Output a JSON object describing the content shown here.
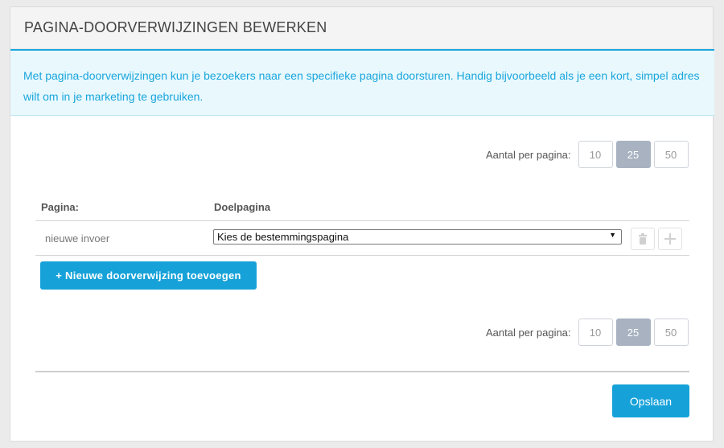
{
  "header": {
    "title": "PAGINA-DOORVERWIJZINGEN BEWERKEN"
  },
  "info": {
    "text": "Met pagina-doorverwijzingen kun je bezoekers naar een specifieke pagina doorsturen. Handig bijvoorbeeld als je een kort, simpel adres wilt om in je marketing te gebruiken."
  },
  "pagination": {
    "label": "Aantal per pagina:",
    "options": [
      "10",
      "25",
      "50"
    ],
    "selected": "25"
  },
  "table": {
    "columns": {
      "page": "Pagina:",
      "target": "Doelpagina"
    },
    "rows": [
      {
        "page": "nieuwe invoer",
        "target_select": "Kies de bestemmingspagina"
      }
    ]
  },
  "actions": {
    "add_label": "+ Nieuwe doorverwijzing toevoegen",
    "save_label": "Opslaan"
  },
  "icons": {
    "delete": "trash-icon",
    "add": "plus-icon",
    "dropdown": "caret-down-icon"
  },
  "colors": {
    "accent": "#16a2d9",
    "info_bg": "#e8f8fd",
    "active_pager": "#a8b2c1"
  }
}
